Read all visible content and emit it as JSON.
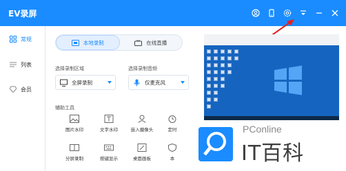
{
  "app": {
    "title": "EV录屏"
  },
  "sidebar": {
    "items": [
      {
        "label": "常规",
        "icon": "grid-icon",
        "active": true
      },
      {
        "label": "列表",
        "icon": "list-icon",
        "active": false
      },
      {
        "label": "会员",
        "icon": "diamond-icon",
        "active": false
      }
    ]
  },
  "mode": {
    "local_label": "本地录制",
    "live_label": "在线直播"
  },
  "region": {
    "label": "选择录制区域",
    "value": "全屏录制"
  },
  "audio": {
    "label": "选择录制音频",
    "value": "仅麦克风"
  },
  "tools": {
    "label": "辅助工具",
    "items": [
      {
        "label": "图片水印",
        "icon": "image-icon"
      },
      {
        "label": "文字水印",
        "icon": "text-t-icon"
      },
      {
        "label": "嵌入摄像头",
        "icon": "camera-user-icon"
      },
      {
        "label": "定时",
        "icon": "clock-icon"
      },
      {
        "label": "分屏录制",
        "icon": "split-screen-icon"
      },
      {
        "label": "按键显示",
        "icon": "keyboard-icon"
      },
      {
        "label": "桌面画板",
        "icon": "drawing-board-icon"
      },
      {
        "label": "本",
        "icon": "shield-icon"
      }
    ]
  },
  "watermark": {
    "brand": "PConline",
    "text": "IT百科"
  },
  "colors": {
    "titlebar": "#1a8cff",
    "accent": "#1a8cff"
  }
}
